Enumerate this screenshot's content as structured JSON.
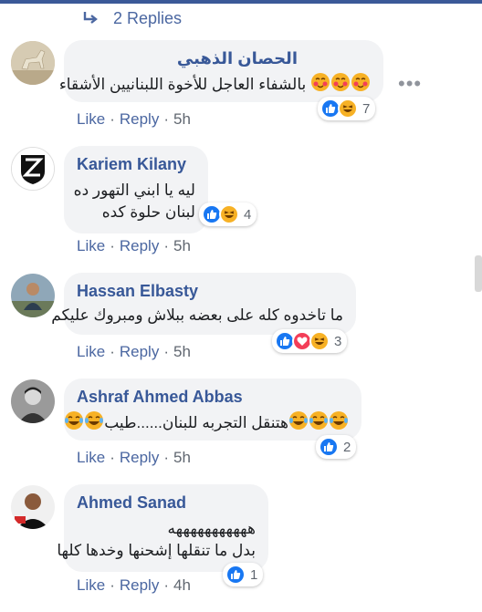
{
  "replies": {
    "label": "2 Replies"
  },
  "comments": [
    {
      "author": "الحصان الذهبي",
      "text": [
        "بالشفاء العاجل للأخوة اللبنانيين الأشقاء"
      ],
      "like": "Like",
      "reply": "Reply",
      "time": "5h",
      "reaction_count": "7"
    },
    {
      "author": "Kariem Kilany",
      "text": [
        "ليه يا ابني التهور ده",
        "لبنان حلوة كده"
      ],
      "like": "Like",
      "reply": "Reply",
      "time": "5h",
      "reaction_count": "4"
    },
    {
      "author": "Hassan Elbasty",
      "text": [
        "ما تاخدوه كله على بعضه ببلاش ومبروك عليكم"
      ],
      "like": "Like",
      "reply": "Reply",
      "time": "5h",
      "reaction_count": "3"
    },
    {
      "author": "Ashraf Ahmed Abbas",
      "text": [
        "هتنقل التجربه للبنان......طيب"
      ],
      "like": "Like",
      "reply": "Reply",
      "time": "5h",
      "reaction_count": "2"
    },
    {
      "author": "Ahmed Sanad",
      "text": [
        "هههههههههههه",
        "بدل ما تنقلها إشحنها وخدها كلها"
      ],
      "like": "Like",
      "reply": "Reply",
      "time": "4h",
      "reaction_count": "1"
    }
  ],
  "more_menu": "•••",
  "colors": {
    "link": "#385898",
    "bubble": "#f2f3f5",
    "meta": "#606770",
    "like_blue": "#1877f2",
    "haha_yellow": "#f7b125",
    "love_red": "#f33e58"
  },
  "icons": {
    "reply_arrow": "reply-arrow-icon",
    "like": "like-reaction-icon",
    "haha": "haha-reaction-icon",
    "love": "love-reaction-icon",
    "blush": "blush-emoji-icon",
    "laugh": "tears-of-joy-emoji-icon"
  }
}
